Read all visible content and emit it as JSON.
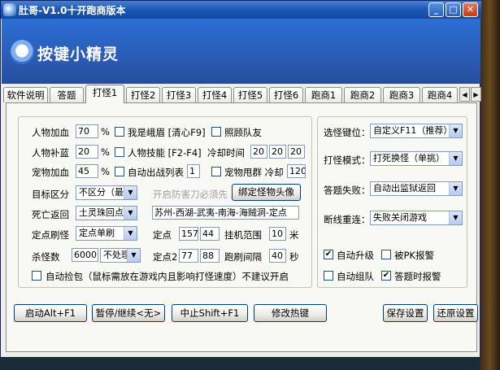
{
  "window": {
    "title": "肚哥-V1.0十开跑商版本",
    "min_glyph": "_",
    "max_glyph": "□",
    "close_glyph": "✕"
  },
  "banner": {
    "brand": "按键小精灵"
  },
  "tabs": [
    "软件说明",
    "答题",
    "打怪1",
    "打怪2",
    "打怪3",
    "打怪4",
    "打怪5",
    "打怪6",
    "跑商1",
    "跑商2",
    "跑商3",
    "跑商4"
  ],
  "active_tab": "打怪1",
  "tab_scroll": {
    "left": "◀",
    "right": "▶"
  },
  "left": {
    "hp_label": "人物加血",
    "hp_value": "70",
    "hp_unit": "%",
    "mp_label": "人物补蓝",
    "mp_value": "20",
    "mp_unit": "%",
    "pet_label": "宠物加血",
    "pet_value": "45",
    "pet_unit": "%",
    "chk_emei": {
      "label": "我是峨眉 [清心F9]",
      "checked": false
    },
    "chk_follow": {
      "label": "照顾队友",
      "checked": false
    },
    "chk_skill": {
      "label": "人物技能 [F2-F4]",
      "checked": false
    },
    "cooldown_label": "冷却时间",
    "cooldown_values": [
      "20",
      "20",
      "20"
    ],
    "chk_battle_list": {
      "label": "自动出战列表",
      "checked": false
    },
    "battle_list_value": "1",
    "chk_pet_swing": {
      "label": "宠物甩群 冷却",
      "checked": false
    },
    "pet_swing_value": "120",
    "target_label": "目标区分",
    "target_select": "不区分（最快",
    "anti_knife_label": "开启防害刀必须先",
    "bind_avatar_btn": "绑定怪物头像",
    "death_label": "死亡返回",
    "death_select": "土灵珠回点",
    "route_value": "苏州-西湖-武夷-南海-海贼洞-定点",
    "fixed_label": "定点刷怪",
    "fixed_select": "定点单刷",
    "point_label": "定点",
    "point_x": "157",
    "point_y": "44",
    "range_label": "挂机范围",
    "range_value": "10",
    "range_unit": "米",
    "kill_label": "杀怪数",
    "kill_value": "6000",
    "kill_select": "不处理",
    "point2_label": "定点2",
    "point2_x": "77",
    "point2_y": "88",
    "refresh_label": "跑刷间隔",
    "refresh_value": "40",
    "refresh_unit": "秒",
    "chk_pickup": {
      "label": "自动捡包（鼠标需放在游戏内且影响打怪速度）不建议开启",
      "checked": false
    }
  },
  "right": {
    "key_label": "选怪键位：",
    "key_select": "自定义F11（推荐）",
    "mode_label": "打怪模式：",
    "mode_select": "打死换怪（单挑）",
    "fail_label": "答题失败：",
    "fail_select": "自动出监狱返回",
    "reconnect_label": "断线重连：",
    "reconnect_select": "失败关闭游戏",
    "chk_auto_level": {
      "label": "自动升级",
      "checked": true
    },
    "chk_pk_alert": {
      "label": "被PK报警",
      "checked": false
    },
    "chk_auto_team": {
      "label": "自动组队",
      "checked": false
    },
    "chk_quiz_alert": {
      "label": "答题时报警",
      "checked": true
    }
  },
  "buttons": {
    "start": "启动Alt+F1",
    "pause": "暂停/继续<无>",
    "stop": "中止Shift+F1",
    "hotkey": "修改热键",
    "save": "保存设置",
    "restore": "还原设置"
  },
  "glyphs": {
    "check": "✔",
    "dropdown": "▼"
  }
}
